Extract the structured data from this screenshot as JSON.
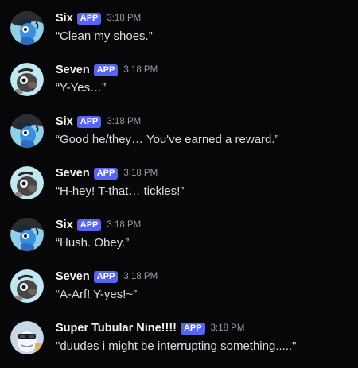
{
  "colors": {
    "background": "#070709",
    "app_badge": "#5865f2",
    "username": "#f2f3f5",
    "timestamp": "#949ba4",
    "message_text": "#dbdee1"
  },
  "messages": [
    {
      "author": "Six",
      "badge": "APP",
      "time": "3:18 PM",
      "text": "“Clean my shoes.”",
      "avatar": "six-avatar"
    },
    {
      "author": "Seven",
      "badge": "APP",
      "time": "3:18 PM",
      "text": "“Y-Yes…”",
      "avatar": "seven-avatar"
    },
    {
      "author": "Six",
      "badge": "APP",
      "time": "3:18 PM",
      "text": "“Good he/they… You've earned a reward.”",
      "avatar": "six-avatar"
    },
    {
      "author": "Seven",
      "badge": "APP",
      "time": "3:18 PM",
      "text": "“H-hey! T-that… tickles!”",
      "avatar": "seven-avatar"
    },
    {
      "author": "Six",
      "badge": "APP",
      "time": "3:18 PM",
      "text": "“Hush. Obey.”",
      "avatar": "six-avatar"
    },
    {
      "author": "Seven",
      "badge": "APP",
      "time": "3:18 PM",
      "text": "“A-Arf! Y-yes!~”",
      "avatar": "seven-avatar"
    },
    {
      "author": "Super Tubular Nine!!!!",
      "badge": "APP",
      "time": "3:18 PM",
      "text": "\"duudes i might be interrupting something.....\"",
      "avatar": "nine-avatar"
    }
  ]
}
